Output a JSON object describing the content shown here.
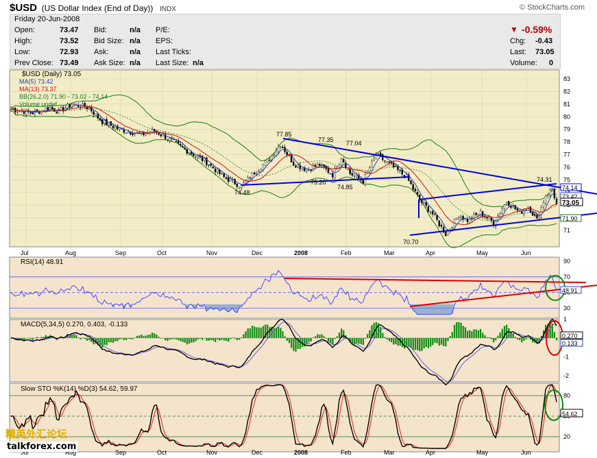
{
  "header": {
    "symbol": "$USD",
    "name": "(US Dollar Index (End of Day))",
    "exchange": "INDX",
    "brand": "© StockCharts.com"
  },
  "quote": {
    "date": "Friday  20-Jun-2008",
    "open_label": "Open:",
    "open": "73.47",
    "high_label": "High:",
    "high": "73.52",
    "low_label": "Low:",
    "low": "72.93",
    "prev_label": "Prev Close:",
    "prev": "73.49",
    "bid_label": "Bid:",
    "bid": "n/a",
    "bidsize_label": "Bid Size:",
    "bidsize": "n/a",
    "ask_label": "Ask:",
    "ask": "n/a",
    "asksize_label": "Ask Size:",
    "asksize": "n/a",
    "pe_label": "P/E:",
    "eps_label": "EPS:",
    "lasttick_label": "Last Ticks:",
    "lastsize_label": "Last Size:",
    "lastsize": "n/a",
    "pct_change": "-0.59%",
    "chg_label": "Chg:",
    "chg": "-0.43",
    "last_label": "Last:",
    "last": "73.05",
    "vol_label": "Volume:",
    "volume": "0"
  },
  "colors": {
    "price_bg": "#f2edc6",
    "ind_bg": "#f4e4cc",
    "up": "#000000",
    "ma5": "#2040c0",
    "ma13": "#d01010",
    "bb": "#1a7a1a",
    "trend": "#0000dd",
    "rsi": "#3a3aff",
    "red_line": "#dd0000",
    "hist": "#0e8a0e"
  },
  "x_months": [
    "Jul",
    "Aug",
    "Sep",
    "Oct",
    "Nov",
    "Dec",
    "2008",
    "Feb",
    "Mar",
    "Apr",
    "May",
    "Jun"
  ],
  "chart_data": [
    {
      "type": "candlestick",
      "title": "$USD (Daily) 73.05",
      "legend": [
        "MA(5) 73.42",
        "MA(13) 73.37",
        "BB(26,2.0) 71.90 - 73.02 - 74.14",
        "Volume undef"
      ],
      "ylim": [
        70.5,
        83.5
      ],
      "yticks": [
        "83",
        "82",
        "81",
        "80",
        "79",
        "78",
        "77",
        "76",
        "75",
        "74",
        "73",
        "72",
        "71"
      ],
      "annotations": [
        "77.85",
        "77.35",
        "77.04",
        "75.20",
        "74.85",
        "74.48",
        "74.31",
        "70.70"
      ],
      "right_labels": [
        "74.14",
        "73.42",
        "73.05",
        "71.90"
      ],
      "key_points": [
        {
          "x": "Jul-2007",
          "y": 80.6
        },
        {
          "x": "Sep-2007",
          "y": 81.0
        },
        {
          "x": "Dec-2007",
          "y": 74.5
        },
        {
          "x": "Dec-2007",
          "y": 77.85
        },
        {
          "x": "Jan-2008",
          "y": 75.2
        },
        {
          "x": "Feb-2008",
          "y": 77.04
        },
        {
          "x": "Mar-2008",
          "y": 70.7
        },
        {
          "x": "Jun-2008",
          "y": 74.31
        },
        {
          "x": "Jun-2008",
          "y": 73.05
        }
      ]
    },
    {
      "type": "line",
      "title": "RSI(14) 48.91",
      "ylim": [
        20,
        90
      ],
      "yticks": [
        "90",
        "70",
        "50",
        "30"
      ],
      "right_label": "48.91",
      "levels": [
        70,
        50,
        30
      ]
    },
    {
      "type": "line",
      "title": "MACD(5,34,5) 0.270, 0.403, -0.133",
      "series_labels": [
        "0.270",
        "0.403",
        "-0.133"
      ],
      "ylim": [
        -2.6,
        2.2
      ],
      "yticks": [
        "1",
        "0",
        "-1",
        "-2"
      ],
      "right_labels": [
        "0.270",
        "0.133"
      ]
    },
    {
      "type": "line",
      "title": "Slow STO %K(14) %D(3) 54.62, 59.97",
      "series_labels": [
        "54.62",
        "59.97"
      ],
      "ylim": [
        5,
        95
      ],
      "yticks": [
        "80",
        "50",
        "20"
      ],
      "right_label": "54.62",
      "levels": [
        80,
        50,
        20
      ]
    }
  ],
  "watermark": {
    "line1": "精英外汇论坛",
    "line2": "talkforex.com"
  }
}
